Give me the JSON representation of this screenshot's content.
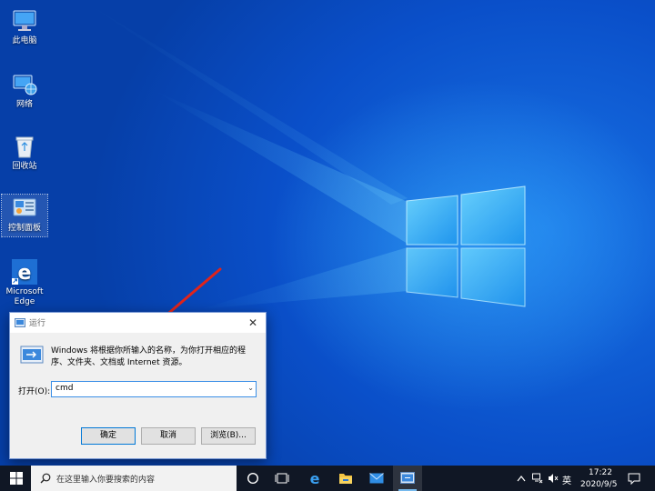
{
  "desktop": {
    "icons": [
      {
        "label": "此电脑"
      },
      {
        "label": "网络"
      },
      {
        "label": "回收站"
      },
      {
        "label": "控制面板"
      },
      {
        "label": "Microsoft Edge"
      }
    ]
  },
  "run_dialog": {
    "title": "运行",
    "close_glyph": "✕",
    "description": "Windows 将根据你所输入的名称，为你打开相应的程序、文件夹、文档或 Internet 资源。",
    "open_label": "打开(O):",
    "input_value": "cmd",
    "ok_label": "确定",
    "cancel_label": "取消",
    "browse_label": "浏览(B)..."
  },
  "taskbar": {
    "search_placeholder": "在这里输入你要搜索的内容",
    "ime_label": "英",
    "time": "17:22",
    "date": "2020/9/5"
  },
  "colors": {
    "desktop_blue": "#0a4fc9",
    "taskbar": "#101725",
    "arrow_red": "#e0241b",
    "accent": "#0078d7"
  }
}
